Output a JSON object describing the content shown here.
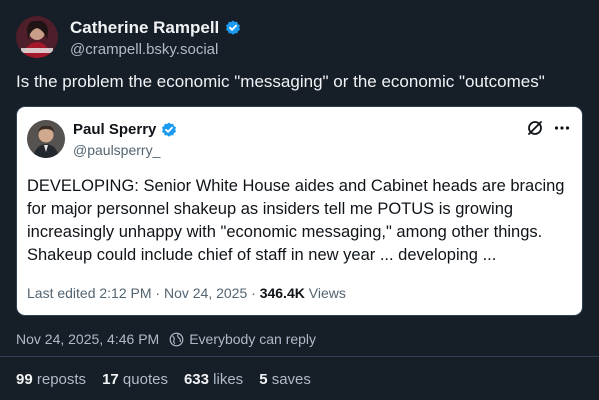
{
  "author": {
    "name": "Catherine Rampell",
    "handle": "@crampell.bsky.social",
    "avatar_icon": "user-avatar"
  },
  "post": {
    "text": "Is the problem the economic \"messaging\" or the economic \"outcomes\""
  },
  "quote": {
    "name": "Paul Sperry",
    "handle": "@paulsperry_",
    "body": "DEVELOPING: Senior White House aides and Cabinet heads are bracing for major personnel shakeup as insiders tell me POTUS is growing increasingly unhappy with \"economic messaging,\" among other things. Shakeup could include chief of staff in new year ... developing ...",
    "meta_prefix": "Last edited 2:12 PM · Nov 24, 2025 · ",
    "views_count": "346.4K",
    "views_label": " Views",
    "icons": [
      "verified-badge-icon",
      "broken-link-icon",
      "more-options-icon"
    ]
  },
  "footer": {
    "timestamp": "Nov 24, 2025, 4:46 PM",
    "reply_permission": "Everybody can reply",
    "stats": [
      {
        "count": "99",
        "label": "reposts"
      },
      {
        "count": "17",
        "label": "quotes"
      },
      {
        "count": "633",
        "label": "likes"
      },
      {
        "count": "5",
        "label": "saves"
      }
    ]
  },
  "colors": {
    "background": "#161e27",
    "verified": "#1d9bf0",
    "muted": "#aebbc9"
  }
}
